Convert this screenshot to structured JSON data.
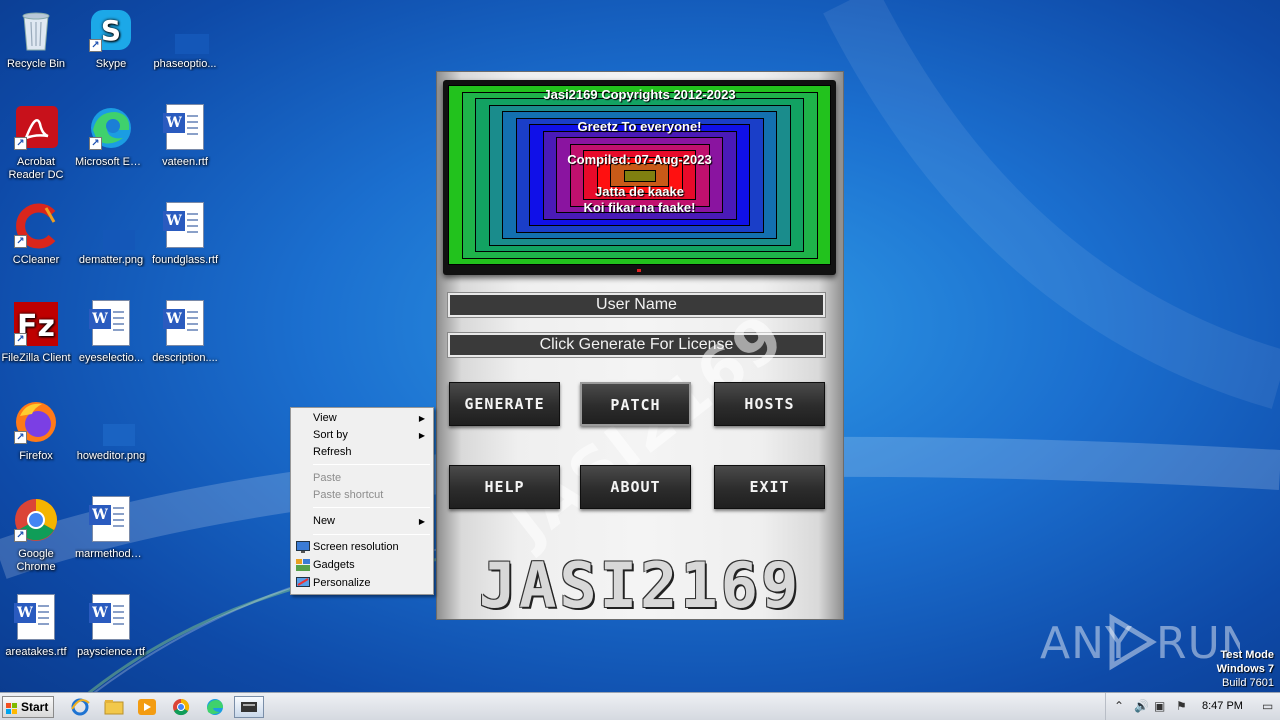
{
  "desktop": {
    "icons": [
      {
        "label": "Recycle Bin",
        "icon": "recycle-bin-icon"
      },
      {
        "label": "Skype",
        "icon": "skype-icon"
      },
      {
        "label": "phaseoptio...",
        "icon": "image-file-icon"
      },
      {
        "label": "Acrobat Reader DC",
        "icon": "acrobat-icon"
      },
      {
        "label": "Microsoft Edge",
        "icon": "edge-icon"
      },
      {
        "label": "vateen.rtf",
        "icon": "word-doc-icon"
      },
      {
        "label": "CCleaner",
        "icon": "ccleaner-icon"
      },
      {
        "label": "dematter.png",
        "icon": "image-file-icon"
      },
      {
        "label": "foundglass.rtf",
        "icon": "word-doc-icon"
      },
      {
        "label": "FileZilla Client",
        "icon": "filezilla-icon"
      },
      {
        "label": "eyeselectio...",
        "icon": "word-doc-icon"
      },
      {
        "label": "description....",
        "icon": "word-doc-icon"
      },
      {
        "label": "Firefox",
        "icon": "firefox-icon"
      },
      {
        "label": "howeditor.png",
        "icon": "image-file-icon"
      },
      {
        "label": "Google Chrome",
        "icon": "chrome-icon"
      },
      {
        "label": "marmethods....",
        "icon": "word-doc-icon"
      },
      {
        "label": "areatakes.rtf",
        "icon": "word-doc-icon"
      },
      {
        "label": "payscience.rtf",
        "icon": "word-doc-icon"
      }
    ]
  },
  "app": {
    "tv_lines": {
      "copyright": "Jasi2169 Copyrights 2012-2023",
      "greetz": "Greetz To everyone!",
      "compiled": "Compiled: 07-Aug-2023",
      "line1": "Jatta de kaake",
      "line2": "Koi fikar na faake!"
    },
    "username_field": "User Name",
    "license_field": "Click Generate For License",
    "buttons": {
      "generate": "GENERATE",
      "patch": "PATCH",
      "hosts": "HOSTS",
      "help": "HELP",
      "about": "ABOUT",
      "exit": "EXIT"
    },
    "logo_text": "JASI2169",
    "colors": {
      "ring_colors": [
        "#22c21d",
        "#1fb34a",
        "#12a262",
        "#1a8c8c",
        "#1370b0",
        "#1a3ec8",
        "#1010e8",
        "#4a1ab8",
        "#8a14a0",
        "#c0106e",
        "#e80a2a",
        "#ff1010",
        "#c85a18",
        "#808010"
      ]
    }
  },
  "context_menu": {
    "items": [
      {
        "label": "View",
        "submenu": true,
        "disabled": false
      },
      {
        "label": "Sort by",
        "submenu": true,
        "disabled": false
      },
      {
        "label": "Refresh",
        "submenu": false,
        "disabled": false
      },
      {
        "label": "Paste",
        "submenu": false,
        "disabled": true
      },
      {
        "label": "Paste shortcut",
        "submenu": false,
        "disabled": true
      },
      {
        "label": "New",
        "submenu": true,
        "disabled": false
      },
      {
        "label": "Screen resolution",
        "submenu": false,
        "disabled": false
      },
      {
        "label": "Gadgets",
        "submenu": false,
        "disabled": false
      },
      {
        "label": "Personalize",
        "submenu": false,
        "disabled": false
      }
    ]
  },
  "watermark": {
    "brand": "ANY RUN"
  },
  "sysinfo": {
    "mode": "Test Mode",
    "os": "Windows 7",
    "build": "Build 7601"
  },
  "taskbar": {
    "start_label": "Start",
    "pinned": [
      "ie-icon",
      "explorer-folder-icon",
      "media-player-icon",
      "chrome-icon",
      "edge-icon",
      "app-window-icon"
    ],
    "clock": "8:47 PM"
  }
}
